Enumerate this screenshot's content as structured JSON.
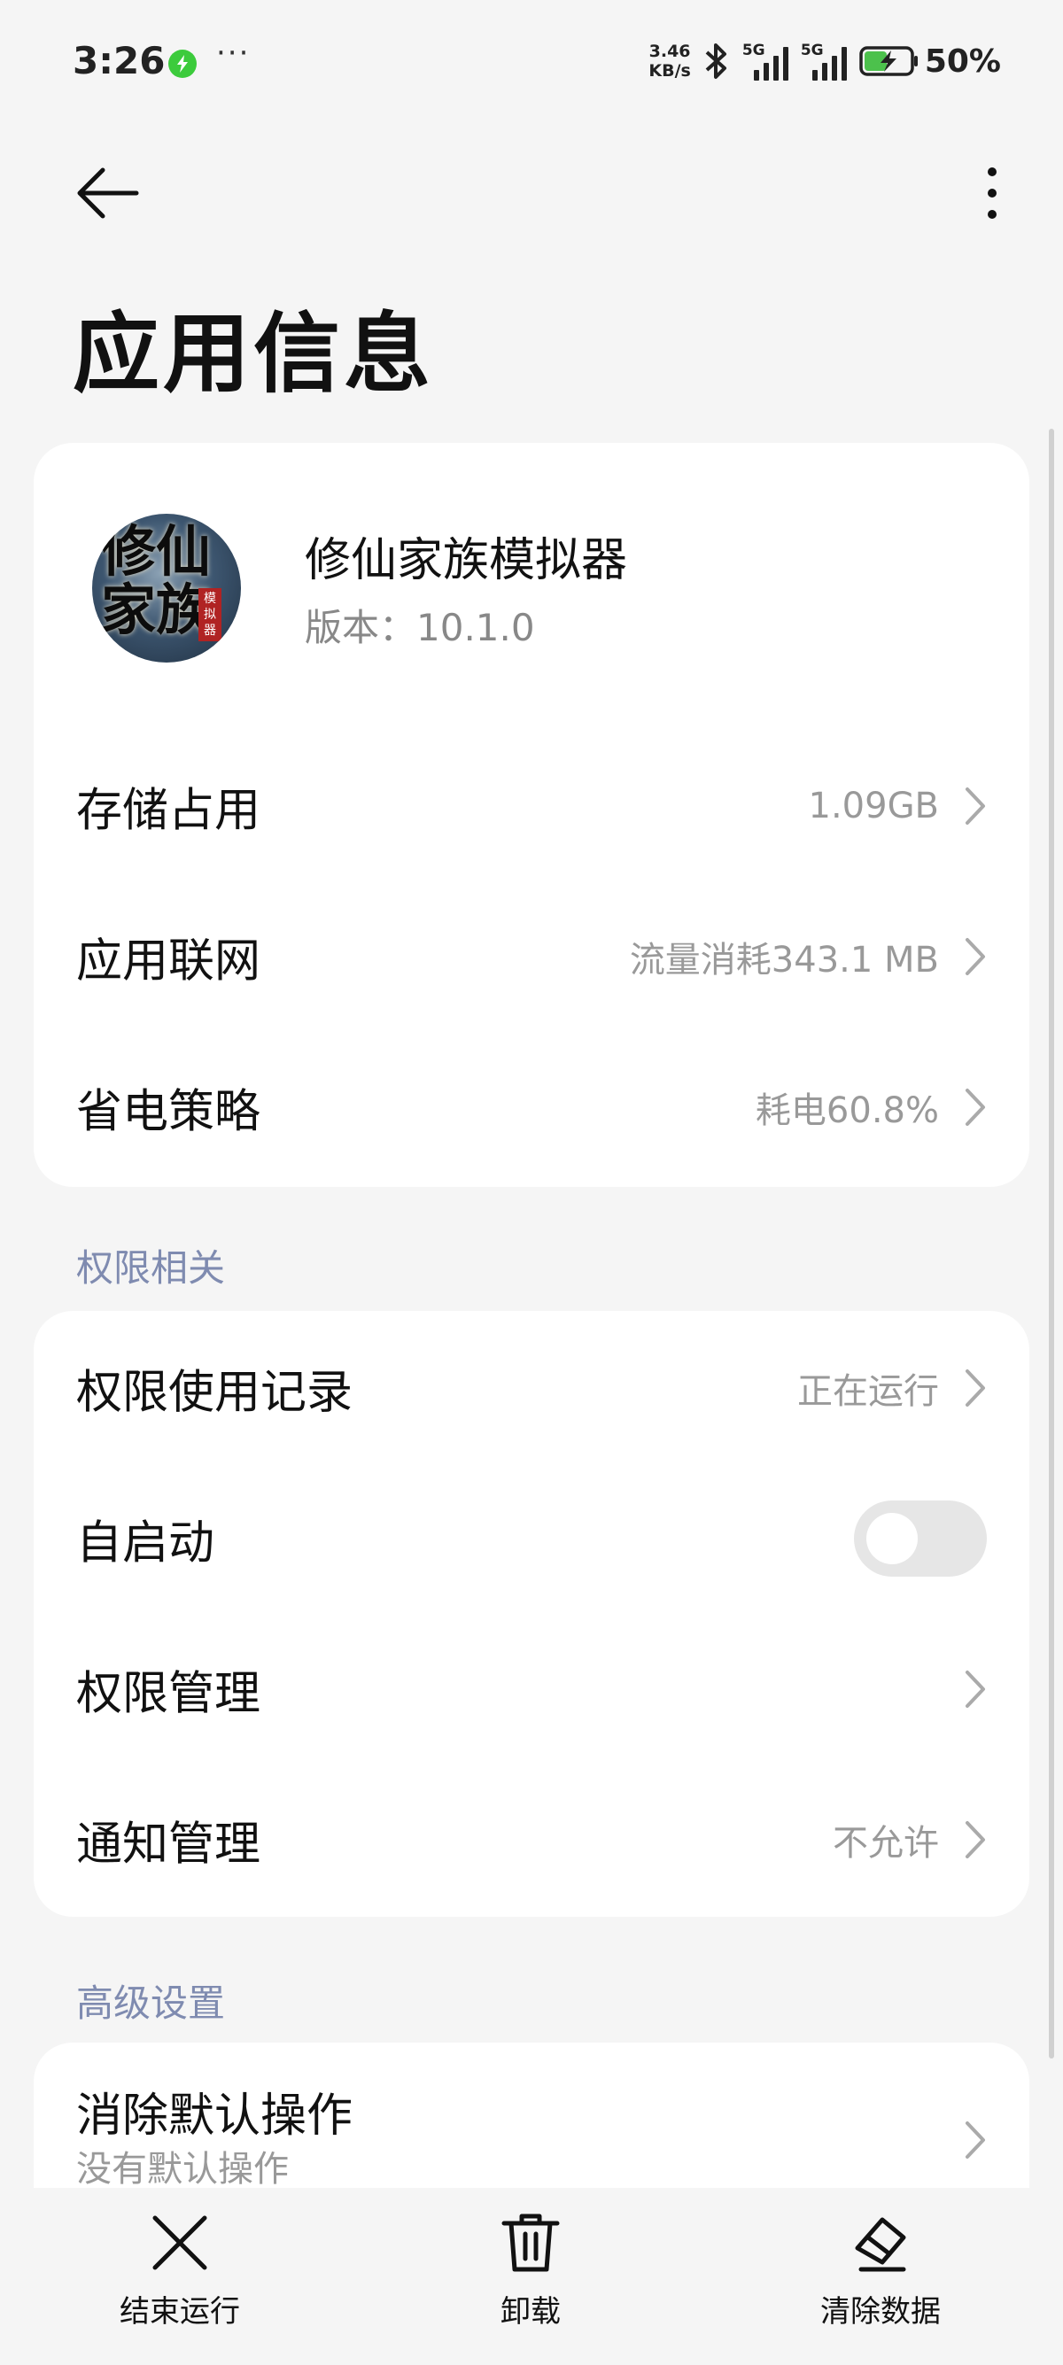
{
  "status_bar": {
    "time": "3:26",
    "more": "···",
    "net_speed_value": "3.46",
    "net_speed_unit": "KB/s",
    "sim1_tag": "5G",
    "sim2_tag": "5G",
    "battery": "50%",
    "battery_level": 0.5,
    "icons": [
      "charging-app-icon",
      "bluetooth-icon",
      "signal-icon",
      "signal-icon",
      "battery-charging-icon"
    ]
  },
  "header": {
    "title": "应用信息",
    "back_icon": "back-arrow-icon",
    "more_icon": "more-vertical-icon"
  },
  "app": {
    "name": "修仙家族模拟器",
    "version": "版本：10.1.0",
    "icon_glyphs": "修仙家族",
    "icon_seal": "模拟器"
  },
  "general_rows": [
    {
      "label": "存储占用",
      "value": "1.09GB"
    },
    {
      "label": "应用联网",
      "value": "流量消耗343.1 MB"
    },
    {
      "label": "省电策略",
      "value": "耗电60.8%"
    }
  ],
  "permissions_section": {
    "title": "权限相关",
    "rows": [
      {
        "label": "权限使用记录",
        "value": "正在运行"
      },
      {
        "label": "自启动",
        "toggle_on": false
      },
      {
        "label": "权限管理",
        "value": ""
      },
      {
        "label": "通知管理",
        "value": "不允许"
      }
    ]
  },
  "advanced_section": {
    "title": "高级设置",
    "rows": [
      {
        "label": "消除默认操作",
        "subtitle": "没有默认操作"
      }
    ]
  },
  "bottom_bar": {
    "stop": "结束运行",
    "uninstall": "卸载",
    "clear": "清除数据"
  }
}
